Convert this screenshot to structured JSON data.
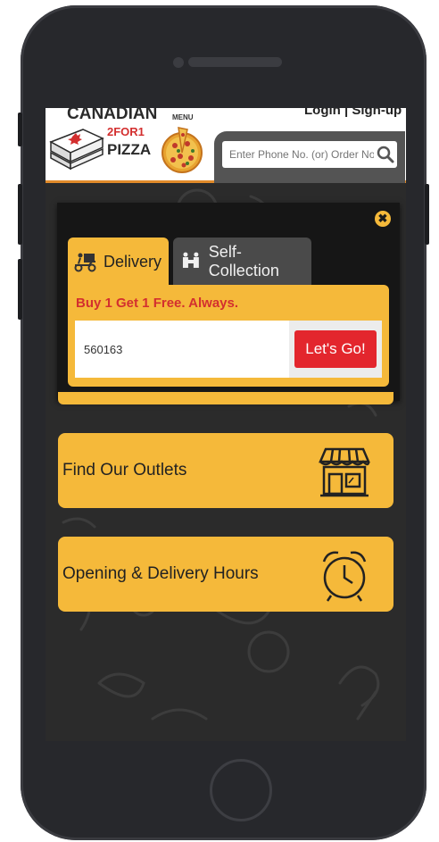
{
  "header": {
    "logo_title": "CANADIAN",
    "logo_sub1": "2FOR1",
    "logo_sub2": "PIZZA",
    "menu_label": "MENU",
    "login_links": "Login | Sign-up",
    "search_placeholder": "Enter Phone No. (or) Order No"
  },
  "modal": {
    "tabs": [
      {
        "label": "Delivery",
        "icon": "delivery-scooter-icon",
        "active": true
      },
      {
        "label": "Self-Collection",
        "icon": "self-collection-icon",
        "active": false
      }
    ],
    "promo_text": "Buy 1 Get 1 Free. Always.",
    "pincode_value": "560163",
    "go_label": "Let's Go!"
  },
  "cards": {
    "outlets_label": "Find Our Outlets",
    "outlets_icon": "store-icon",
    "hours_label": "Opening & Delivery Hours",
    "hours_icon": "alarm-clock-icon"
  },
  "colors": {
    "accent": "#f5b93a",
    "cta": "#e3262d",
    "promo": "#d32f2f",
    "background": "#2b2b2b"
  }
}
